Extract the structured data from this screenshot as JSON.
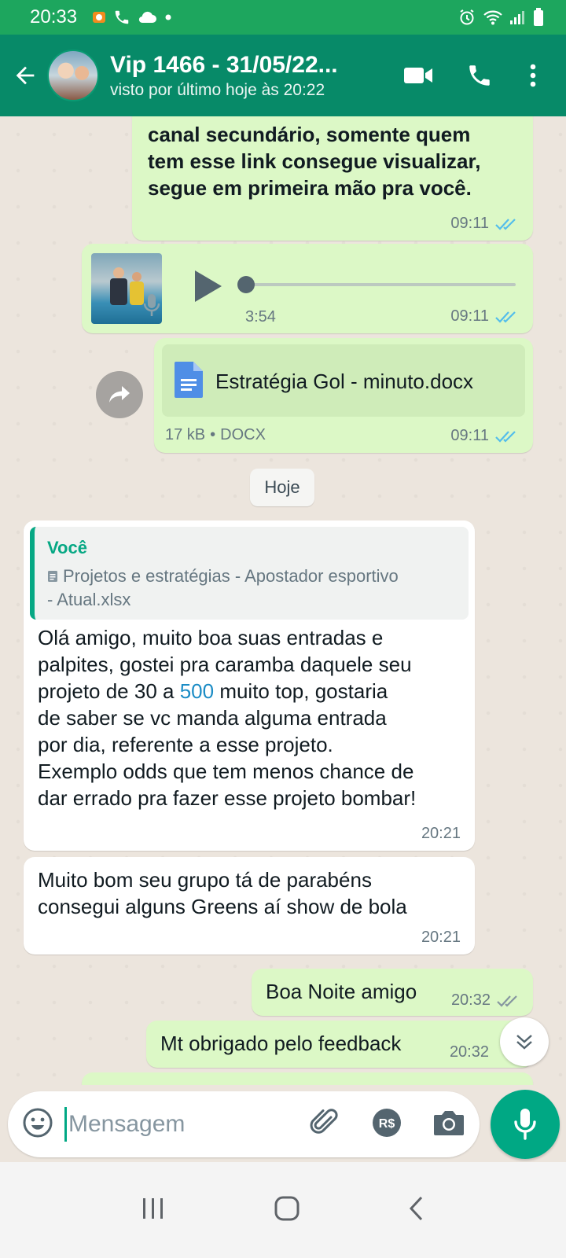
{
  "status_bar": {
    "time": "20:33"
  },
  "header": {
    "title": "Vip 1466 - 31/05/22...",
    "subtitle": "visto por último hoje às 20:22"
  },
  "messages": [
    {
      "type": "text-outgoing",
      "lines": [
        "canal secundário, somente quem",
        "tem esse link consegue visualizar,",
        "segue em primeira mão pra você."
      ],
      "time": "09:11"
    },
    {
      "type": "audio-outgoing",
      "duration": "3:54",
      "time": "09:11"
    },
    {
      "type": "document-outgoing",
      "filename": "Estratégia Gol - minuto.docx",
      "size": "17 kB",
      "separator": "•",
      "filetype": "DOCX",
      "time": "09:11"
    },
    {
      "type": "date-divider",
      "label": "Hoje"
    },
    {
      "type": "text-incoming-reply",
      "quote_author": "Você",
      "quote_line1": "Projetos e estratégias - Apostador esportivo",
      "quote_line2": "- Atual.xlsx",
      "text_line1": "Olá amigo, muito boa suas entradas e",
      "text_line2": "palpites, gostei pra caramba daquele seu",
      "text_line3_a": "projeto de 30 a ",
      "text_line3_link": "500",
      "text_line3_b": " muito top, gostaria",
      "text_line4": "de saber se vc manda alguma entrada",
      "text_line5": "por dia, referente a esse projeto.",
      "text_line6": "Exemplo odds que tem menos chance de",
      "text_line7": "dar errado pra fazer esse projeto bombar!",
      "time": "20:21"
    },
    {
      "type": "text-incoming",
      "line1": "Muito bom seu grupo tá de parabéns",
      "line2": "consegui alguns Greens aí show de bola",
      "time": "20:21"
    },
    {
      "type": "text-outgoing",
      "text": "Boa Noite amigo",
      "time": "20:32"
    },
    {
      "type": "text-outgoing",
      "text": "Mt obrigado pelo feedback",
      "time": "20:32"
    }
  ],
  "input": {
    "placeholder": "Mensagem"
  },
  "colors": {
    "header": "#078a68",
    "status_bar": "#1da65e",
    "outgoing_bubble": "#dcf8c6",
    "incoming_bubble": "#ffffff",
    "accent": "#00a884",
    "read_ticks": "#53bdeb"
  }
}
